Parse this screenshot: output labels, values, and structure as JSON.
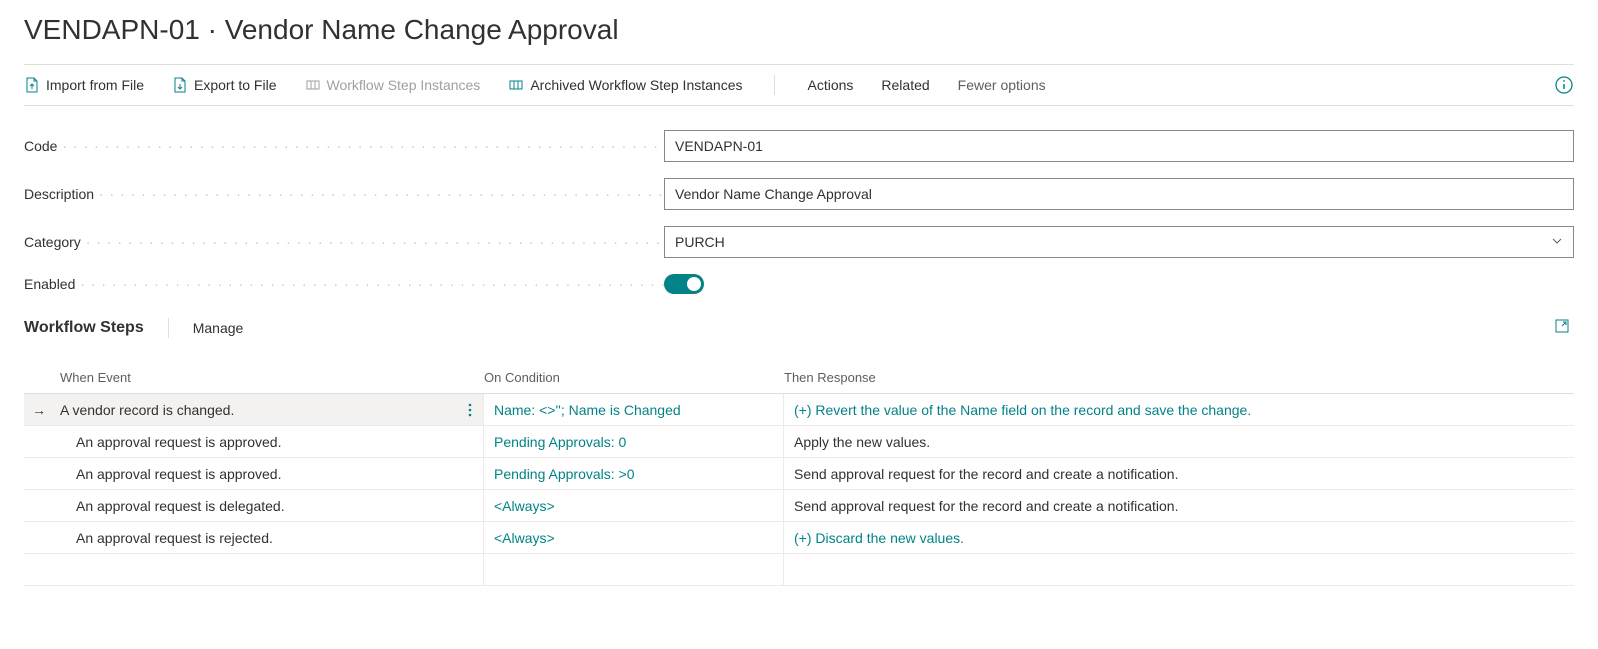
{
  "title": "VENDAPN-01 · Vendor Name Change Approval",
  "actions": {
    "import": "Import from File",
    "export": "Export to File",
    "wf_step_instances": "Workflow Step Instances",
    "archived_wf_step_instances": "Archived Workflow Step Instances",
    "actions_menu": "Actions",
    "related_menu": "Related",
    "fewer_options": "Fewer options"
  },
  "fields": {
    "code_label": "Code",
    "code_value": "VENDAPN-01",
    "description_label": "Description",
    "description_value": "Vendor Name Change Approval",
    "category_label": "Category",
    "category_value": "PURCH",
    "enabled_label": "Enabled"
  },
  "section": {
    "title": "Workflow Steps",
    "manage": "Manage"
  },
  "columns": {
    "event": "When Event",
    "condition": "On Condition",
    "response": "Then Response"
  },
  "rows": [
    {
      "event": "A vendor record is changed.",
      "indent": false,
      "selected": true,
      "condition": "Name: <>''; Name is Changed",
      "response": "(+) Revert the value of the Name field on the record and save the change.",
      "response_link": true
    },
    {
      "event": "An approval request is approved.",
      "indent": true,
      "selected": false,
      "condition": "Pending Approvals: 0",
      "response": "Apply the new values.",
      "response_link": false
    },
    {
      "event": "An approval request is approved.",
      "indent": true,
      "selected": false,
      "condition": "Pending Approvals: >0",
      "response": "Send approval request for the record and create a notification.",
      "response_link": false
    },
    {
      "event": "An approval request is delegated.",
      "indent": true,
      "selected": false,
      "condition": "<Always>",
      "response": "Send approval request for the record and create a notification.",
      "response_link": false
    },
    {
      "event": "An approval request is rejected.",
      "indent": true,
      "selected": false,
      "condition": "<Always>",
      "response": "(+) Discard the new values.",
      "response_link": true
    }
  ]
}
